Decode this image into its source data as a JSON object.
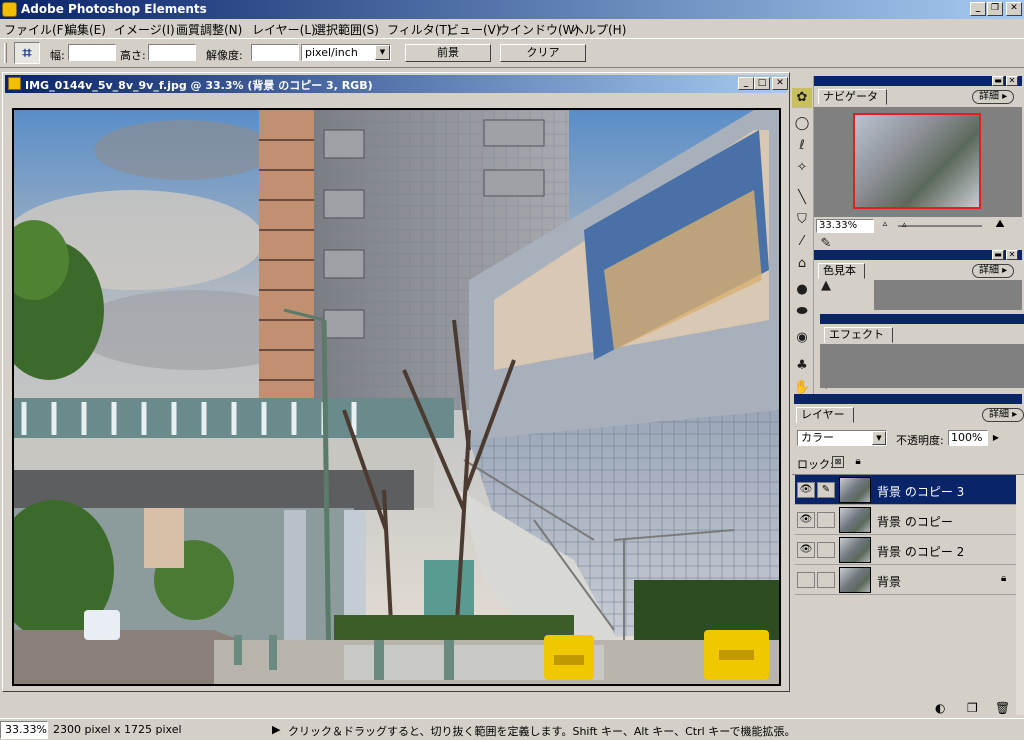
{
  "app": {
    "title": "Adobe Photoshop Elements"
  },
  "menu": [
    "ファイル(F)",
    "編集(E)",
    "イメージ(I)",
    "画質調整(N)",
    "レイヤー(L)",
    "選択範囲(S)",
    "フィルタ(T)",
    "ビュー(V)",
    "ウインドウ(W)",
    "ヘルプ(H)"
  ],
  "options": {
    "width_label": "幅:",
    "height_label": "高さ:",
    "resolution_label": "解像度:",
    "unit_value": "pixel/inch",
    "front_button": "前景",
    "clear_button": "クリア"
  },
  "document": {
    "title": "IMG_0144v_5v_8v_9v_f.jpg @ 33.3% (背景 のコピー 3, RGB)"
  },
  "status": {
    "zoom": "33.33%",
    "size": "2300 pixel x 1725 pixel",
    "hint": "クリック＆ドラッグすると、切り抜く範囲を定義します。Shift キー、Alt キー、Ctrl キーで機能拡張。"
  },
  "navigator": {
    "tab": "ナビゲータ",
    "details": "詳細",
    "zoom": "33.33%"
  },
  "swatches": {
    "tab": "色見本",
    "details": "詳細"
  },
  "effects": {
    "tab": "エフェクト"
  },
  "layers": {
    "tab": "レイヤー",
    "details": "詳細",
    "mode": "カラー",
    "opacity_label": "不透明度:",
    "opacity_value": "100%",
    "lock_label": "ロック:",
    "items": [
      {
        "name": "背景 のコピー 3",
        "visible": true,
        "selected": true
      },
      {
        "name": "背景 のコピー",
        "visible": true,
        "selected": false
      },
      {
        "name": "背景 のコピー 2",
        "visible": true,
        "selected": false
      },
      {
        "name": "背景",
        "visible": false,
        "selected": false,
        "locked": true
      }
    ]
  },
  "colors": {
    "titlebar_start": "#0a246a",
    "titlebar_end": "#a6caf0",
    "chrome": "#d4d0c8",
    "selection": "#0a246a"
  }
}
